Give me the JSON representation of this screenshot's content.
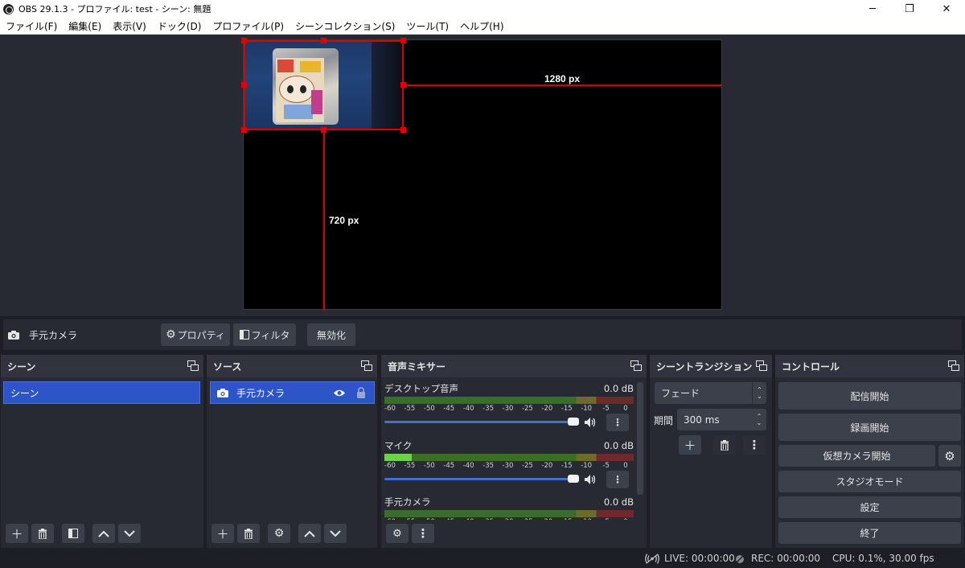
{
  "window": {
    "title": "OBS 29.1.3 - プロファイル: test - シーン: 無題",
    "minimize_glyph": "─",
    "restore_glyph": "❐",
    "close_glyph": "✕"
  },
  "menu": [
    "ファイル(F)",
    "編集(E)",
    "表示(V)",
    "ドック(D)",
    "プロファイル(P)",
    "シーンコレクション(S)",
    "ツール(T)",
    "ヘルプ(H)"
  ],
  "preview": {
    "width_label": "1280 px",
    "height_label": "720 px"
  },
  "source_toolbar": {
    "source_name": "手元カメラ",
    "properties": "プロパティ",
    "filters": "フィルタ",
    "deactivate": "無効化"
  },
  "scenes": {
    "title": "シーン",
    "items": [
      "シーン"
    ]
  },
  "sources": {
    "title": "ソース",
    "items": [
      {
        "name": "手元カメラ",
        "visible": true,
        "locked": true
      }
    ]
  },
  "mixer": {
    "title": "音声ミキサー",
    "ticks": [
      "-60",
      "-55",
      "-50",
      "-45",
      "-40",
      "-35",
      "-30",
      "-25",
      "-20",
      "-15",
      "-10",
      "-5",
      "0"
    ],
    "channels": [
      {
        "name": "デスクトップ音声",
        "db": "0.0 dB",
        "level": 0.0
      },
      {
        "name": "マイク",
        "db": "0.0 dB",
        "level": 0.11
      },
      {
        "name": "手元カメラ",
        "db": "0.0 dB",
        "level": 0.0
      }
    ]
  },
  "transitions": {
    "title": "シーントランジション",
    "selected": "フェード",
    "duration_label": "期間",
    "duration_value": "300 ms"
  },
  "controls": {
    "title": "コントロール",
    "start_streaming": "配信開始",
    "start_recording": "録画開始",
    "start_virtual_cam": "仮想カメラ開始",
    "studio_mode": "スタジオモード",
    "settings": "設定",
    "exit": "終了"
  },
  "status": {
    "live": "LIVE: 00:00:00",
    "rec": "REC: 00:00:00",
    "cpu": "CPU: 0.1%, 30.00 fps"
  },
  "colors": {
    "accent": "#2d55c7",
    "guide": "#e00000",
    "fader": "#3a72d9"
  }
}
